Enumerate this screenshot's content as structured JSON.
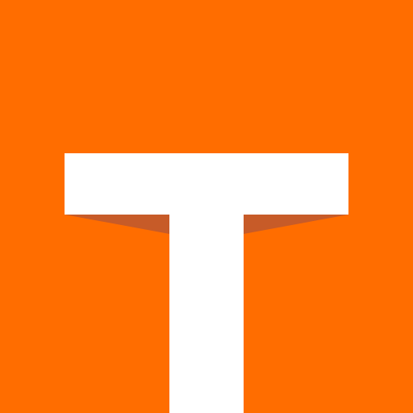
{
  "logo": {
    "letter": "T",
    "colors": {
      "background": "#FF6D00",
      "letter": "#FFFFFF",
      "shadow": "#C75B28"
    }
  }
}
